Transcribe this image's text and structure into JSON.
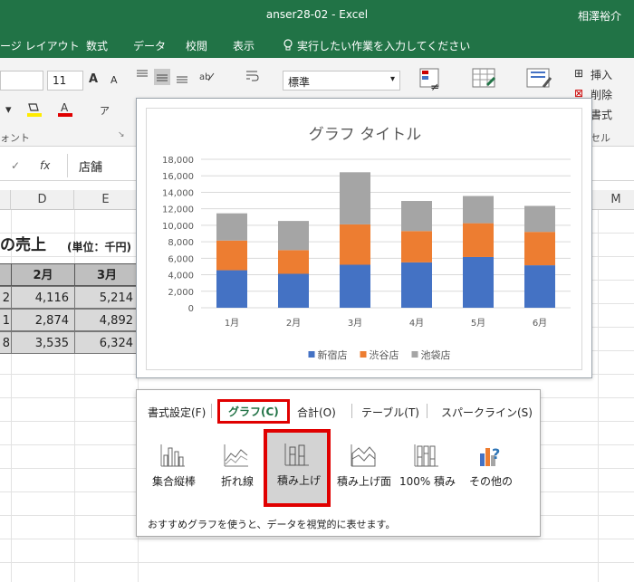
{
  "window": {
    "title": "anser28-02 - Excel",
    "user": "相澤裕介"
  },
  "tabs": [
    {
      "label": "ージ レイアウト"
    },
    {
      "label": "数式"
    },
    {
      "label": "データ"
    },
    {
      "label": "校閲"
    },
    {
      "label": "表示"
    }
  ],
  "tell_me": "実行したい作業を入力してください",
  "ribbon": {
    "font_size": "11",
    "grow_font": "A",
    "shrink_font": "A",
    "number_format": "標準",
    "insert": "挿入",
    "delete": "削除",
    "format": "書式",
    "font_group": "ォント",
    "cells_group": "セル"
  },
  "formula_bar": {
    "fx": "fx",
    "value": "店舗"
  },
  "columns": [
    "D",
    "E",
    "M"
  ],
  "sheet": {
    "title": "の売上",
    "unit": "(単位：千円)",
    "headers": [
      "2月",
      "3月"
    ],
    "row_stubs": [
      "2",
      "1",
      "8"
    ],
    "rows": [
      [
        "4,116",
        "5,214"
      ],
      [
        "2,874",
        "4,892"
      ],
      [
        "3,535",
        "6,324"
      ]
    ]
  },
  "chart_data": {
    "type": "bar",
    "stacked": true,
    "title": "グラフ タイトル",
    "categories": [
      "1月",
      "2月",
      "3月",
      "4月",
      "5月",
      "6月"
    ],
    "series": [
      {
        "name": "新宿店",
        "color": "#4472c4",
        "values": [
          4550,
          4116,
          5214,
          5500,
          6150,
          5150
        ]
      },
      {
        "name": "渋谷店",
        "color": "#ed7d31",
        "values": [
          3600,
          2874,
          4892,
          3800,
          4100,
          4050
        ]
      },
      {
        "name": "池袋店",
        "color": "#a5a5a5",
        "values": [
          3300,
          3535,
          6324,
          3650,
          3300,
          3150
        ]
      }
    ],
    "ylim": [
      0,
      18000
    ],
    "yticks": [
      "0",
      "2,000",
      "4,000",
      "6,000",
      "8,000",
      "10,000",
      "12,000",
      "14,000",
      "16,000",
      "18,000"
    ],
    "legend": "bottom",
    "grid": true
  },
  "quick_analysis": {
    "tabs": [
      {
        "label": "書式設定(F)"
      },
      {
        "label": "グラフ(C)"
      },
      {
        "label": "合計(O)"
      },
      {
        "label": "テーブル(T)"
      },
      {
        "label": "スパークライン(S)"
      }
    ],
    "items": [
      {
        "label": "集合縦棒"
      },
      {
        "label": "折れ線"
      },
      {
        "label": "積み上げ"
      },
      {
        "label": "積み上げ面"
      },
      {
        "label": "100% 積み"
      },
      {
        "label": "その他の"
      }
    ],
    "hint": "おすすめグラフを使うと、データを視覚的に表せます。"
  }
}
